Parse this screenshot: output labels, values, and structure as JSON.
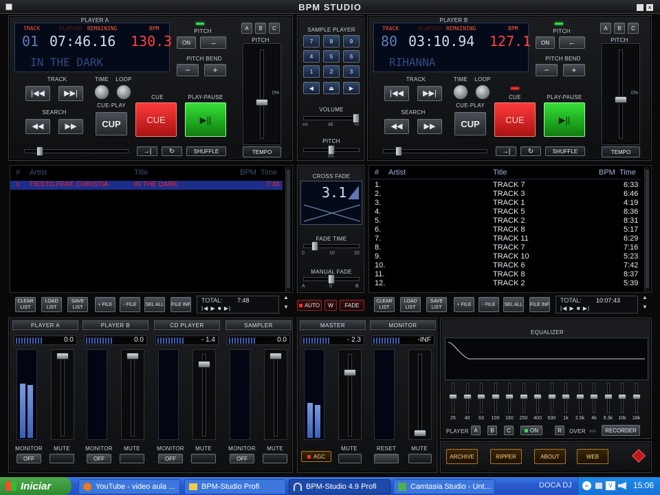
{
  "window": {
    "title": "BPM STUDIO"
  },
  "player_a": {
    "label": "PLAYER A",
    "lcd_labels": {
      "track": "TRACK",
      "elapsed": "ELAPSED",
      "remaining": "REMAINING",
      "bpm": "BPM"
    },
    "track_no": "01",
    "time": "07:46.16",
    "bpm": "130.3",
    "title": "IN THE DARK",
    "pitch_label": "PITCH",
    "pitch_on": "ON",
    "pitch_arrow": "→",
    "pitch_bend_label": "PITCH BEND",
    "pitch_bend_minus": "−",
    "pitch_bend_plus": "+",
    "abc": [
      "A",
      "B",
      "C"
    ],
    "fader_pitch_label": "PITCH",
    "tempo_label": "TEMPO",
    "scale_zero": "0%",
    "track_label": "TRACK",
    "search_label": "SEARCH",
    "time_label": "TIME",
    "loop_label": "LOOP",
    "cue_play_label": "CUE-PLAY",
    "cup_label": "CUP",
    "cue_top_label": "CUE",
    "cue_big": "CUE",
    "play_pause_label": "PLAY-PAUSE",
    "play_symbol": "▶||",
    "shuffle": "SHUFFLE"
  },
  "player_b": {
    "label": "PLAYER B",
    "lcd_labels": {
      "track": "TRACK",
      "elapsed": "ELAPSED",
      "remaining": "REMAINING",
      "bpm": "BPM"
    },
    "track_no": "80",
    "time": "03:10.94",
    "bpm": "127.1",
    "title": "RIHANNA",
    "pitch_label": "PITCH",
    "pitch_on": "ON",
    "pitch_arrow": "←",
    "pitch_bend_label": "PITCH BEND",
    "pitch_bend_minus": "−",
    "pitch_bend_plus": "+",
    "abc": [
      "A",
      "B",
      "C"
    ],
    "fader_pitch_label": "PITCH",
    "tempo_label": "TEMPO",
    "scale_zero": "0%",
    "track_label": "TRACK",
    "search_label": "SEARCH",
    "time_label": "TIME",
    "loop_label": "LOOP",
    "cue_play_label": "CUE-PLAY",
    "cup_label": "CUP",
    "cue_top_label": "CUE",
    "cue_big": "CUE",
    "play_pause_label": "PLAY-PAUSE",
    "play_symbol": "▶||",
    "shuffle": "SHUFFLE"
  },
  "sample_player": {
    "label": "SAMPLE PLAYER",
    "keys": [
      "7",
      "8",
      "9",
      "4",
      "5",
      "6",
      "1",
      "2",
      "3"
    ],
    "volume_label": "VOLUME",
    "vol_min": "-inf",
    "vol_unit": "dB",
    "vol_max": "+0",
    "pitch_label": "PITCH",
    "pitch_zero": "0%"
  },
  "playlist_a": {
    "headers": {
      "num": "#",
      "artist": "Artist",
      "title": "Title",
      "bpm": "BPM",
      "time": "Time"
    },
    "rows": [
      {
        "num": "1",
        "artist": "TIESTO FEAT. CHRISTIA",
        "title": "IN THE DARK",
        "bpm": "",
        "time": "7:48"
      }
    ],
    "buttons": [
      "CLEAR LIST",
      "LOAD LIST",
      "SAVE LIST",
      "+ FILE",
      "- FILE",
      "SEL ALL",
      "FILE INF"
    ],
    "total_label": "TOTAL:",
    "total": "7:48"
  },
  "playlist_b": {
    "headers": {
      "num": "#",
      "artist": "Artist",
      "title": "Title",
      "bpm": "BPM",
      "time": "Time"
    },
    "rows": [
      {
        "num": "1.",
        "title": "TRACK 7",
        "time": "6:33"
      },
      {
        "num": "2.",
        "title": "TRACK 3",
        "time": "6:46"
      },
      {
        "num": "3.",
        "title": "TRACK 1",
        "time": "4:19"
      },
      {
        "num": "4.",
        "title": "TRACK 5",
        "time": "8:36"
      },
      {
        "num": "5.",
        "title": "TRACK 2",
        "time": "8:31"
      },
      {
        "num": "6.",
        "title": "TRACK 8",
        "time": "5:17"
      },
      {
        "num": "7.",
        "title": "TRACK 11",
        "time": "6:29"
      },
      {
        "num": "8.",
        "title": "TRACK 7",
        "time": "7:16"
      },
      {
        "num": "9.",
        "title": "TRACK 10",
        "time": "5:23"
      },
      {
        "num": "10.",
        "title": "TRACK 6",
        "time": "7:42"
      },
      {
        "num": "11.",
        "title": "TRACK 8",
        "time": "8:37"
      },
      {
        "num": "12.",
        "title": "TRACK 2",
        "time": "5:39"
      }
    ],
    "buttons": [
      "CLEAR LIST",
      "LOAD LIST",
      "SAVE LIST",
      "+ FILE",
      "- FILE",
      "SEL ALL",
      "FILE INF"
    ],
    "total_label": "TOTAL:",
    "total": "10:07:43"
  },
  "crossfade": {
    "label": "CROSS FADE",
    "value": "3.1",
    "fade_time_label": "FADE TIME",
    "fade_ticks": [
      "0",
      "10",
      "20"
    ],
    "manual_fade_label": "MANUAL FADE",
    "manual_ticks": [
      "A",
      "0",
      "B"
    ],
    "auto": "AUTO",
    "w": "W",
    "fade": "FADE"
  },
  "mixer": {
    "channels": [
      {
        "label": "PLAYER A",
        "value": "0.0",
        "monitor_label": "MONITOR",
        "mute_label": "MUTE",
        "monitor": "OFF",
        "level": 0.62
      },
      {
        "label": "PLAYER B",
        "value": "0.0",
        "monitor_label": "MONITOR",
        "mute_label": "MUTE",
        "monitor": "OFF",
        "level": 0.0
      },
      {
        "label": "CD PLAYER",
        "value": "- 1.4",
        "monitor_label": "MONITOR",
        "mute_label": "MUTE",
        "monitor": "OFF",
        "level": 0.0
      },
      {
        "label": "SAMPLER",
        "value": "0.0",
        "monitor_label": "MONITOR",
        "mute_label": "MUTE",
        "monitor": "OFF",
        "level": 0.0
      }
    ],
    "master": {
      "label": "MASTER",
      "value": "- 2.3",
      "agc": "AGC",
      "mute": "MUTE",
      "level": 0.4
    },
    "monitor": {
      "label": "MONITOR",
      "value": "-INF",
      "reset": "RESET",
      "mute": "MUTE",
      "level": 0.0
    }
  },
  "equalizer": {
    "label": "EQUALIZER",
    "bands": [
      "25",
      "40",
      "63",
      "100",
      "160",
      "250",
      "400",
      "630",
      "1k",
      "2.5k",
      "4k",
      "6.3k",
      "10k",
      "16k"
    ],
    "player_label": "PLAYER",
    "abc": [
      "A",
      "B",
      "C"
    ],
    "on": "ON",
    "r": "R",
    "over": "OVER",
    "recorder": "RECORDER"
  },
  "bottom_buttons": [
    "ARCHIVE",
    "RIPPER",
    "ABOUT",
    "WEB"
  ],
  "taskbar": {
    "start": "Iniciar",
    "items": [
      "YouTube - video aula ...",
      "BPM-Studio Profi",
      "BPM-Studio 4.9 Profi",
      "Camtasia Studio - Unt..."
    ],
    "tray_text": "DOCA DJ",
    "clock": "15:06"
  },
  "colors": {
    "accent_red": "#ff3b3b",
    "lcd_blue": "#3c5a8c",
    "cue_red": "#d42020",
    "play_green": "#1fa81f"
  }
}
